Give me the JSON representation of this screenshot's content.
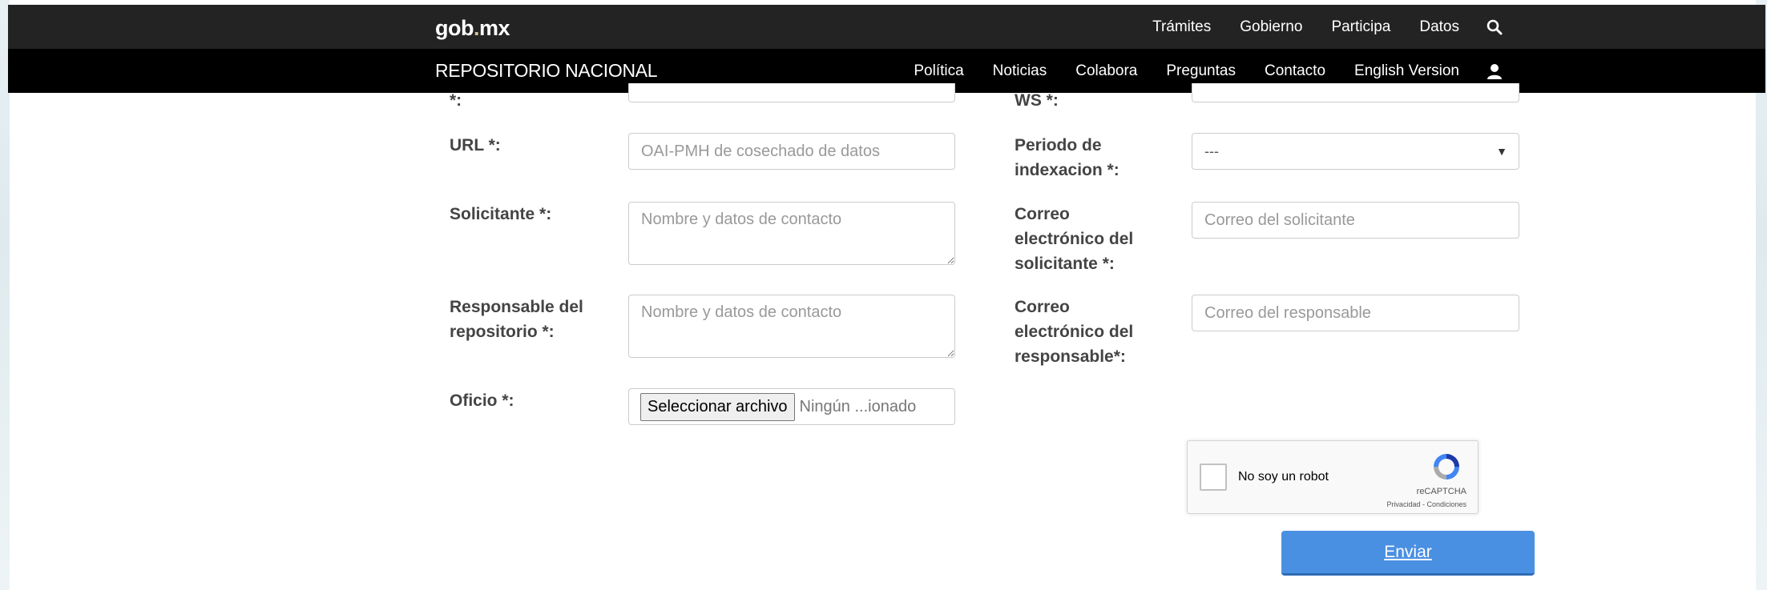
{
  "header": {
    "brand_left": "gob",
    "brand_dot": ".",
    "brand_right": "mx",
    "nav": [
      "Trámites",
      "Gobierno",
      "Participa",
      "Datos"
    ],
    "search_icon": "search-icon"
  },
  "subheader": {
    "title": "REPOSITORIO NACIONAL",
    "nav": [
      "Política",
      "Noticias",
      "Colabora",
      "Preguntas",
      "Contacto",
      "English Version"
    ],
    "user_icon": "user-icon"
  },
  "form": {
    "partial_label_left": "*:",
    "partial_label_right": "WS *:",
    "url_label": "URL *:",
    "url_placeholder": "OAI-PMH de cosechado de datos",
    "periodo_label_1": "Periodo de",
    "periodo_label_2": "indexacion *:",
    "periodo_value": "---",
    "solicitante_label": "Solicitante *:",
    "solicitante_placeholder": "Nombre y datos de contacto",
    "correo_sol_label_1": "Correo",
    "correo_sol_label_2": "electrónico del",
    "correo_sol_label_3": "solicitante *:",
    "correo_sol_placeholder": "Correo del solicitante",
    "responsable_label_1": "Responsable del",
    "responsable_label_2": "repositorio *:",
    "responsable_placeholder": "Nombre y datos de contacto",
    "correo_resp_label_1": "Correo",
    "correo_resp_label_2": "electrónico del",
    "correo_resp_label_3": "responsable*:",
    "correo_resp_placeholder": "Correo del responsable",
    "oficio_label": "Oficio *:",
    "file_button": "Seleccionar archivo",
    "file_status": "Ningún ...ionado"
  },
  "captcha": {
    "label": "No soy un robot",
    "brand": "reCAPTCHA",
    "links": "Privacidad - Condiciones"
  },
  "submit_label": "Enviar",
  "colors": {
    "topbar": "#232323",
    "subbar": "#000000",
    "accent": "#4a90e2"
  }
}
